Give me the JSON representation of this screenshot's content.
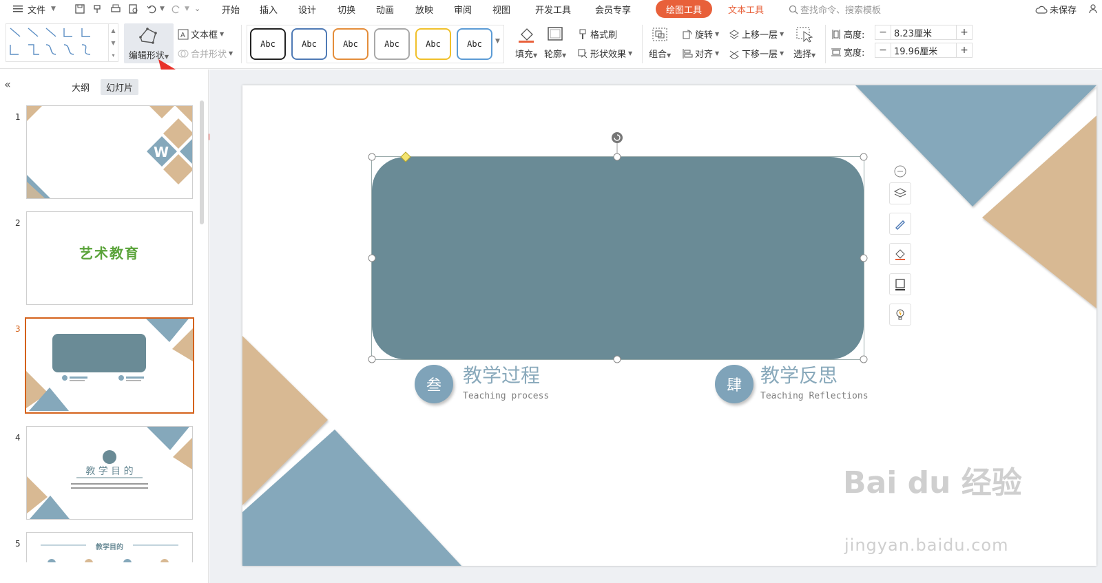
{
  "menubar": {
    "file_label": "文件",
    "tabs": [
      "开始",
      "插入",
      "设计",
      "切换",
      "动画",
      "放映",
      "审阅",
      "视图",
      "开发工具",
      "会员专享"
    ],
    "drawing_tools": "绘图工具",
    "text_tools": "文本工具",
    "search_placeholder": "查找命令、搜索模板",
    "unsaved": "未保存"
  },
  "ribbon": {
    "edit_shape": "编辑形状",
    "text_box": "文本框",
    "merge_shape": "合并形状",
    "style_sample": "Abc",
    "style_colors": [
      "#222222",
      "#4f7ab5",
      "#e48d3a",
      "#a8a8a8",
      "#f0c02a",
      "#5b9bd5"
    ],
    "fill": "填充",
    "outline": "轮廓",
    "format_painter": "格式刷",
    "shape_effects": "形状效果",
    "group": "组合",
    "rotate": "旋转",
    "align": "对齐",
    "bring_forward": "上移一层",
    "send_backward": "下移一层",
    "select": "选择",
    "height_label": "高度:",
    "height_value": "8.23厘米",
    "width_label": "宽度:",
    "width_value": "19.96厘米"
  },
  "leftpanel": {
    "tab_outline": "大纲",
    "tab_slides": "幻灯片",
    "slides": [
      {
        "num": "1"
      },
      {
        "num": "2",
        "text": "艺术教育"
      },
      {
        "num": "3"
      },
      {
        "num": "4",
        "text": "教 学 目 的"
      },
      {
        "num": "5",
        "text": "教学目的"
      }
    ]
  },
  "slide": {
    "item3": {
      "badge": "叁",
      "title": "教学过程",
      "subtitle": "Teaching process"
    },
    "item4": {
      "badge": "肆",
      "title": "教学反思",
      "subtitle": "Teaching Reflections"
    }
  },
  "watermark": {
    "main": "Bai du 经验",
    "sub": "jingyan.baidu.com"
  },
  "colors": {
    "accent": "#e8603a",
    "shape_fill": "#6a8b96",
    "blue_tri": "#85a8bb",
    "tan_tri": "#d8b993"
  }
}
